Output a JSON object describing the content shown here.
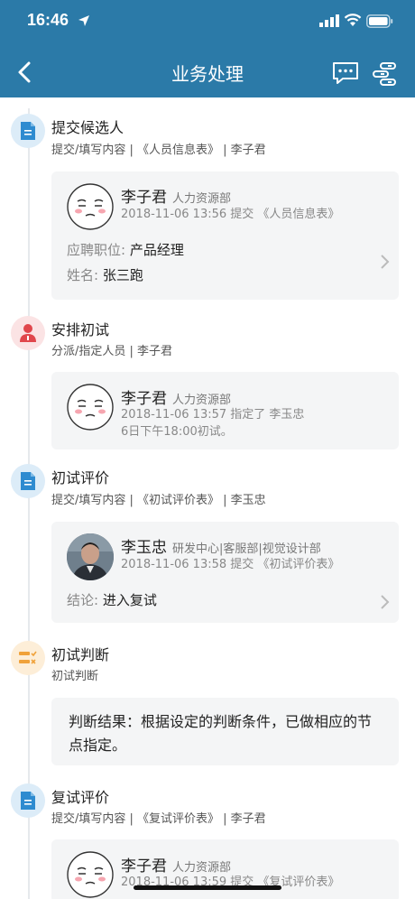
{
  "status_bar": {
    "time": "16:46"
  },
  "nav": {
    "title": "业务处理"
  },
  "steps": [
    {
      "title": "提交候选人",
      "subtitle": "提交/填写内容 | 《人员信息表》 | 李子君",
      "card": {
        "name": "李子君",
        "dept": "人力资源部",
        "action": "2018-11-06 13:56 提交 《人员信息表》",
        "fields": [
          {
            "label": "应聘职位: ",
            "value": "产品经理"
          },
          {
            "label": "姓名: ",
            "value": "张三跑"
          }
        ]
      }
    },
    {
      "title": "安排初试",
      "subtitle": "分派/指定人员 | 李子君",
      "card": {
        "name": "李子君",
        "dept": "人力资源部",
        "action_line1": "2018-11-06 13:57 指定了 李玉忠",
        "action_line2": "6日下午18:00初试。"
      }
    },
    {
      "title": "初试评价",
      "subtitle": "提交/填写内容 | 《初试评价表》 | 李玉忠",
      "card": {
        "name": "李玉忠",
        "dept": "研发中心|客服部|视觉设计部",
        "action": "2018-11-06 13:58 提交 《初试评价表》",
        "fields": [
          {
            "label": "结论: ",
            "value": "进入复试"
          }
        ]
      }
    },
    {
      "title": "初试判断",
      "subtitle": "初试判断",
      "card": {
        "text": "判断结果：根据设定的判断条件，已做相应的节点指定。"
      }
    },
    {
      "title": "复试评价",
      "subtitle": "提交/填写内容 | 《复试评价表》 | 李子君",
      "card": {
        "name": "李子君",
        "dept": "人力资源部",
        "action": "2018-11-06 13:59 提交 《复试评价表》"
      }
    }
  ],
  "colors": {
    "header": "#2b7aa8",
    "doc_icon": "#2e8bd0",
    "doc_icon_bg": "#dcecf8",
    "person_icon": "#e0474c",
    "person_icon_bg": "#fbe3e4",
    "judge_icon": "#f0a23a",
    "judge_icon_bg": "#fdeed8"
  }
}
